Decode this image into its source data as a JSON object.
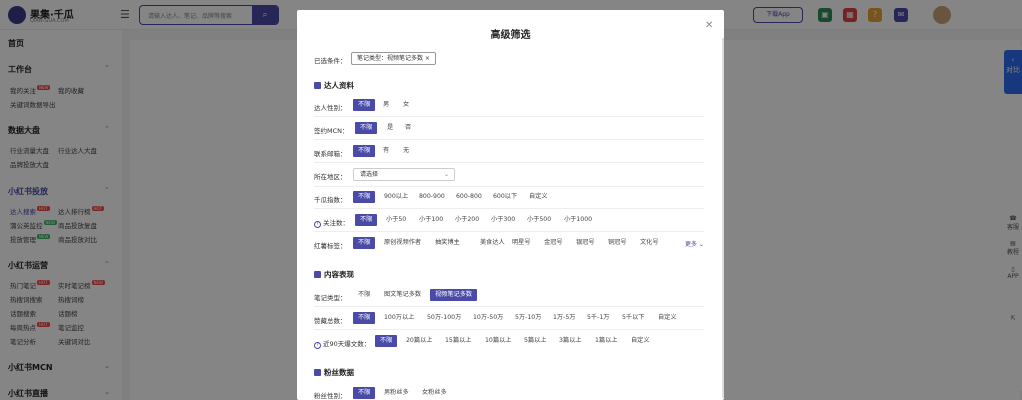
{
  "topbar": {
    "logo_text": "果集·千瓜",
    "logo_sub": "QIAN-GUA.COM",
    "search_placeholder": "请输入达人、笔记、品牌等搜索",
    "download_app": "下载App"
  },
  "sidebar": {
    "home": "首页",
    "workbench": "工作台",
    "my_focus": "我的关注",
    "my_collection": "我的收藏",
    "keyword_export": "关键词数据导出",
    "data_board": "数据大盘",
    "industry_board": "行业流量大盘",
    "industry_kol_board": "行业达人大盘",
    "brand_board": "品牌投放大盘",
    "rednote_ads": "小红书投放",
    "kol_search": "达人搜索",
    "kol_rank": "达人排行榜",
    "pgy_monitor": "蒲公英监控",
    "product_delivery_review": "商品投放复盘",
    "delivery_mgmt": "投放管理",
    "product_delivery_compare": "商品投放对比",
    "rednote_ops": "小红书运营",
    "hot_notes": "热门笔记",
    "live_notes_rank": "实时笔记榜",
    "hot_search": "热搜词搜索",
    "hot_rank": "热搜词榜",
    "topic_search": "话题搜索",
    "topic_rank": "话题榜",
    "daily_hot": "每周热点",
    "note_monitor": "笔记监控",
    "note_analysis": "笔记分析",
    "keyword_compare": "关键词对比",
    "rednote_mcn": "小红书MCN",
    "rednote_live": "小红书直播"
  },
  "modal": {
    "title": "高级筛选",
    "selected_label": "已选条件：",
    "selected_tag": "笔记类型：视频笔记多数",
    "section_kol": "达人资料",
    "gender_label": "达人性别：",
    "gender_opts": [
      "不限",
      "男",
      "女"
    ],
    "mcn_label": "签约MCN：",
    "mcn_opts": [
      "不限",
      "是",
      "否"
    ],
    "contact_label": "联系邮箱：",
    "contact_opts": [
      "不限",
      "有",
      "无"
    ],
    "region_label": "所在地区：",
    "region_placeholder": "请选择",
    "fans_label": "千瓜指数：",
    "fans_opts": [
      "不限",
      "900以上",
      "800-900",
      "600-800",
      "600以下",
      "自定义"
    ],
    "focus_label": "关注数：",
    "focus_opts": [
      "不限",
      "小于50",
      "小于100",
      "小于200",
      "小于300",
      "小于500",
      "小于1000"
    ],
    "tags_label": "红薯标签：",
    "tags_opts": [
      "不限",
      "原创视频作者",
      "抽奖博主",
      "美食达人",
      "明星号",
      "金冠号",
      "银冠号",
      "铜冠号",
      "文化号"
    ],
    "more": "更多",
    "section_content": "内容表现",
    "note_type_label": "笔记类型：",
    "note_type_opts": [
      "不限",
      "图文笔记多数",
      "视频笔记多数"
    ],
    "likes_label": "赞藏总数：",
    "likes_opts": [
      "不限",
      "100万以上",
      "50万-100万",
      "10万-50万",
      "5万-10万",
      "1万-5万",
      "5千-1万",
      "5千以下",
      "自定义"
    ],
    "interact_label": "近90天爆文数：",
    "interact_opts": [
      "不限",
      "20篇以上",
      "15篇以上",
      "10篇以上",
      "5篇以上",
      "3篇以上",
      "1篇以上",
      "自定义"
    ],
    "section_fans": "粉丝数据",
    "fans_gender_label": "粉丝性别：",
    "fans_gender_opts": [
      "不限",
      "男粉丝多",
      "女粉丝多"
    ]
  },
  "right_panel": {
    "compare": "对比",
    "service": "客服",
    "tutorial": "教程",
    "app": "APP"
  },
  "colors": {
    "accent": "#4a4aa8",
    "hot": "#f04848"
  }
}
